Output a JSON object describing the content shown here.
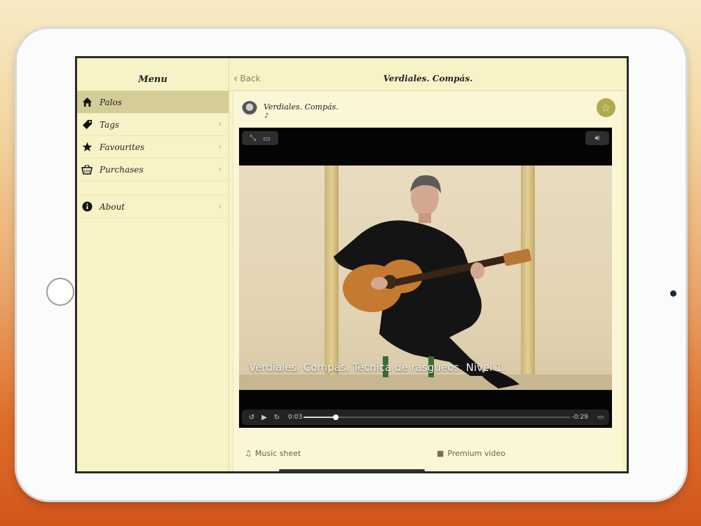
{
  "sidebar": {
    "title": "Menu",
    "items": [
      {
        "label": "Palos",
        "icon": "home-icon"
      },
      {
        "label": "Tags",
        "icon": "tag-icon"
      },
      {
        "label": "Favourites",
        "icon": "star-icon"
      },
      {
        "label": "Purchases",
        "icon": "basket-icon"
      },
      {
        "label": "About",
        "icon": "info-icon"
      }
    ],
    "selected": "Palos"
  },
  "navbar": {
    "back_label": "Back",
    "title": "Verdiales. Compás."
  },
  "video_header": {
    "title": "Verdiales. Compás.",
    "note": "♪"
  },
  "player": {
    "subtitle": "Verdiales. Compás. Técnica de rasgueos. Nivel 1.",
    "elapsed": "0:03",
    "remaining": "-0:29",
    "progress": 0.12
  },
  "links": {
    "music_sheet": "Music sheet",
    "premium_video": "Premium video"
  },
  "colors": {
    "background_top": "#f7ebc4",
    "background_bottom": "#d2561c",
    "app_bg": "#f8f3c7",
    "selected_row": "#d5cd98",
    "favourite_button": "#b0a94e"
  }
}
